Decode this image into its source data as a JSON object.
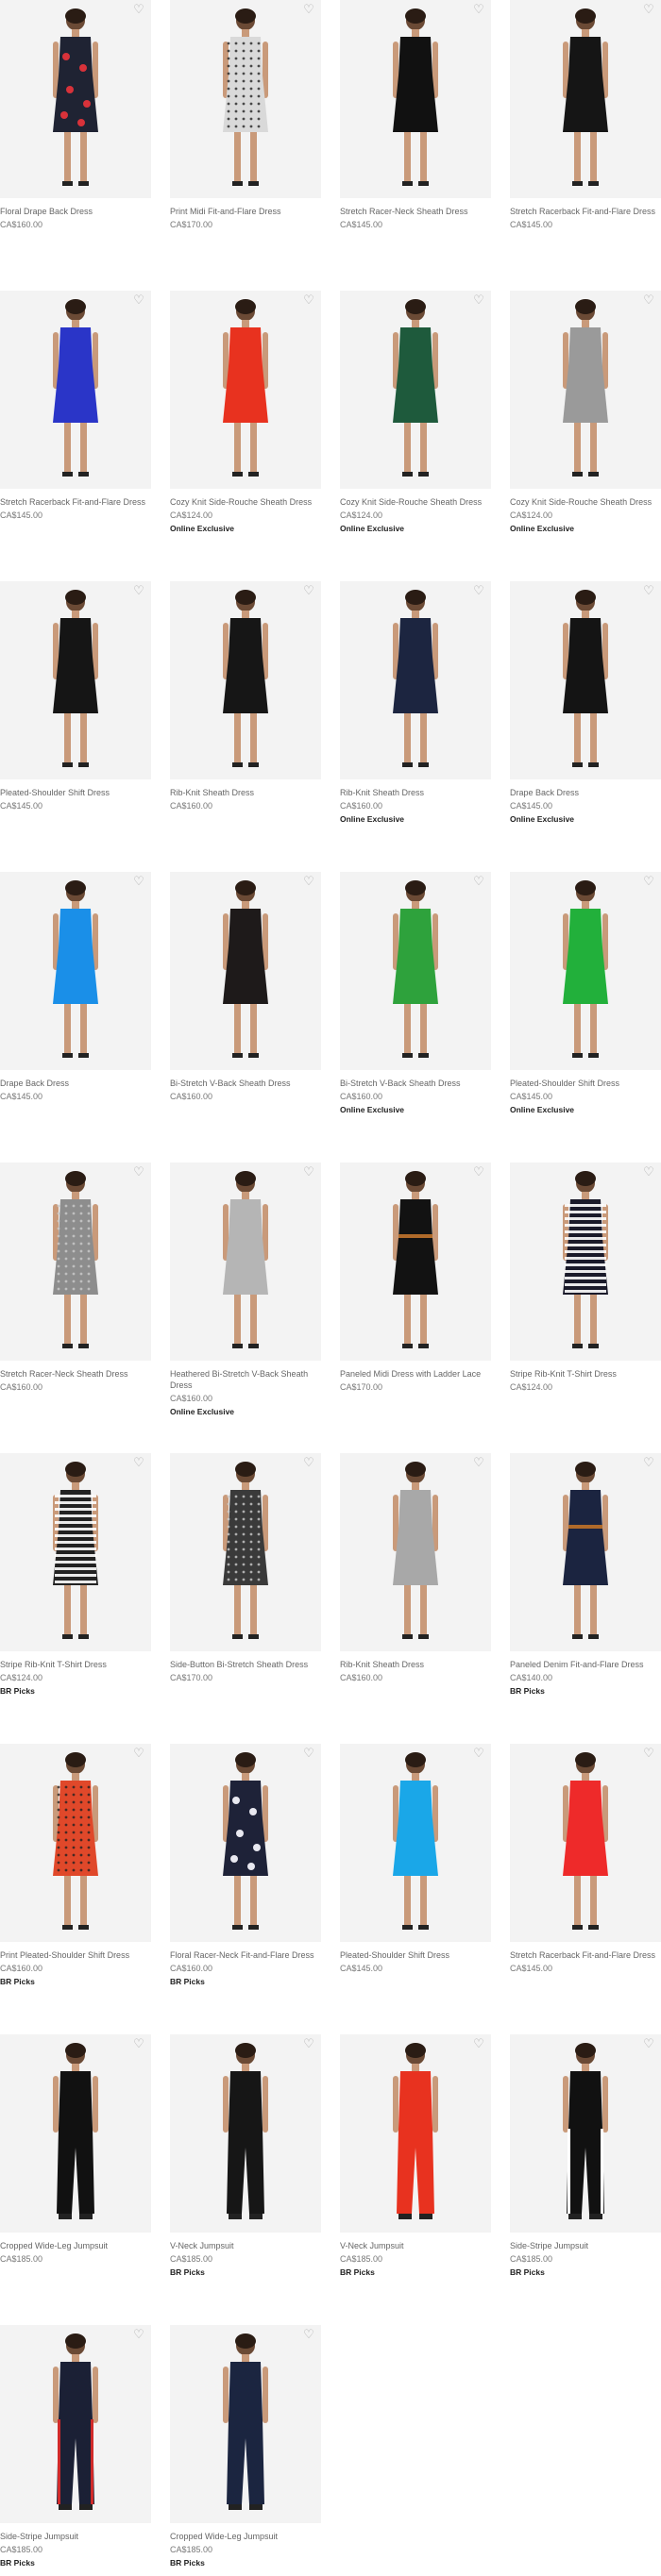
{
  "products": [
    {
      "name": "Floral Drape Back Dress",
      "price": "CA$160.00",
      "badge": "",
      "color": "#1f2333",
      "pattern": "floral-red"
    },
    {
      "name": "Print Midi Fit-and-Flare Dress",
      "price": "CA$170.00",
      "badge": "",
      "color": "#d9d9d9",
      "pattern": "dots"
    },
    {
      "name": "Stretch Racer-Neck Sheath Dress",
      "price": "CA$145.00",
      "badge": "",
      "color": "#111111",
      "pattern": "solid"
    },
    {
      "name": "Stretch Racerback Fit-and-Flare Dress",
      "price": "CA$145.00",
      "badge": "",
      "color": "#151515",
      "pattern": "solid"
    },
    {
      "name": "Stretch Racerback Fit-and-Flare Dress",
      "price": "CA$145.00",
      "badge": "",
      "color": "#2a35c8",
      "pattern": "solid"
    },
    {
      "name": "Cozy Knit Side-Rouche Sheath Dress",
      "price": "CA$124.00",
      "badge": "Online Exclusive",
      "color": "#e8321f",
      "pattern": "solid"
    },
    {
      "name": "Cozy Knit Side-Rouche Sheath Dress",
      "price": "CA$124.00",
      "badge": "Online Exclusive",
      "color": "#1e5a3c",
      "pattern": "solid"
    },
    {
      "name": "Cozy Knit Side-Rouche Sheath Dress",
      "price": "CA$124.00",
      "badge": "Online Exclusive",
      "color": "#9a9a9a",
      "pattern": "solid"
    },
    {
      "name": "Pleated-Shoulder Shift Dress",
      "price": "CA$145.00",
      "badge": "",
      "color": "#151515",
      "pattern": "solid"
    },
    {
      "name": "Rib-Knit Sheath Dress",
      "price": "CA$160.00",
      "badge": "",
      "color": "#161616",
      "pattern": "solid"
    },
    {
      "name": "Rib-Knit Sheath Dress",
      "price": "CA$160.00",
      "badge": "Online Exclusive",
      "color": "#1c2540",
      "pattern": "solid"
    },
    {
      "name": "Drape Back Dress",
      "price": "CA$145.00",
      "badge": "Online Exclusive",
      "color": "#141414",
      "pattern": "solid"
    },
    {
      "name": "Drape Back Dress",
      "price": "CA$145.00",
      "badge": "",
      "color": "#1a8fe8",
      "pattern": "solid"
    },
    {
      "name": "Bi-Stretch V-Back Sheath Dress",
      "price": "CA$160.00",
      "badge": "",
      "color": "#1e1a1a",
      "pattern": "solid"
    },
    {
      "name": "Bi-Stretch V-Back Sheath Dress",
      "price": "CA$160.00",
      "badge": "Online Exclusive",
      "color": "#2ea23c",
      "pattern": "solid"
    },
    {
      "name": "Pleated-Shoulder Shift Dress",
      "price": "CA$145.00",
      "badge": "Online Exclusive",
      "color": "#22b03b",
      "pattern": "solid"
    },
    {
      "name": "Stretch Racer-Neck Sheath Dress",
      "price": "CA$160.00",
      "badge": "",
      "color": "#8d8d8d",
      "pattern": "check"
    },
    {
      "name": "Heathered Bi-Stretch V-Back Sheath Dress",
      "price": "CA$160.00",
      "badge": "Online Exclusive",
      "color": "#b5b5b5",
      "pattern": "solid"
    },
    {
      "name": "Paneled Midi Dress with Ladder Lace",
      "price": "CA$170.00",
      "badge": "",
      "color": "#121212",
      "pattern": "belt"
    },
    {
      "name": "Stripe Rib-Knit T-Shirt Dress",
      "price": "CA$124.00",
      "badge": "",
      "color": "#1a1a2a",
      "pattern": "stripes"
    },
    {
      "name": "Stripe Rib-Knit T-Shirt Dress",
      "price": "CA$124.00",
      "badge": "BR Picks",
      "color": "#222222",
      "pattern": "stripes"
    },
    {
      "name": "Side-Button Bi-Stretch Sheath Dress",
      "price": "CA$170.00",
      "badge": "",
      "color": "#3a3a3a",
      "pattern": "check"
    },
    {
      "name": "Rib-Knit Sheath Dress",
      "price": "CA$160.00",
      "badge": "",
      "color": "#a8a8a8",
      "pattern": "solid"
    },
    {
      "name": "Paneled Denim Fit-and-Flare Dress",
      "price": "CA$140.00",
      "badge": "BR Picks",
      "color": "#1b2440",
      "pattern": "belt"
    },
    {
      "name": "Print Pleated-Shoulder Shift Dress",
      "price": "CA$160.00",
      "badge": "BR Picks",
      "color": "#e0482a",
      "pattern": "dots"
    },
    {
      "name": "Floral Racer-Neck Fit-and-Flare Dress",
      "price": "CA$160.00",
      "badge": "BR Picks",
      "color": "#1e2238",
      "pattern": "floral-white"
    },
    {
      "name": "Pleated-Shoulder Shift Dress",
      "price": "CA$145.00",
      "badge": "",
      "color": "#1aa7e8",
      "pattern": "solid"
    },
    {
      "name": "Stretch Racerback Fit-and-Flare Dress",
      "price": "CA$145.00",
      "badge": "",
      "color": "#ee2a2a",
      "pattern": "solid"
    },
    {
      "name": "Cropped Wide-Leg Jumpsuit",
      "price": "CA$185.00",
      "badge": "",
      "color": "#111111",
      "pattern": "jumpsuit"
    },
    {
      "name": "V-Neck Jumpsuit",
      "price": "CA$185.00",
      "badge": "BR Picks",
      "color": "#161616",
      "pattern": "jumpsuit"
    },
    {
      "name": "V-Neck Jumpsuit",
      "price": "CA$185.00",
      "badge": "BR Picks",
      "color": "#e8321f",
      "pattern": "jumpsuit"
    },
    {
      "name": "Side-Stripe Jumpsuit",
      "price": "CA$185.00",
      "badge": "BR Picks",
      "color": "#111111",
      "pattern": "jumpsuit-stripe"
    },
    {
      "name": "Side-Stripe Jumpsuit",
      "price": "CA$185.00",
      "badge": "BR Picks",
      "color": "#1b2035",
      "pattern": "jumpsuit-stripe-red"
    },
    {
      "name": "Cropped Wide-Leg Jumpsuit",
      "price": "CA$185.00",
      "badge": "BR Picks",
      "color": "#1b2540",
      "pattern": "jumpsuit"
    }
  ],
  "icons": {
    "favorite": "heart-outline-icon"
  },
  "colors": {
    "photo_bg": "#f3f3f3",
    "badge": "#222222",
    "price": "#777777",
    "name": "#666666"
  }
}
